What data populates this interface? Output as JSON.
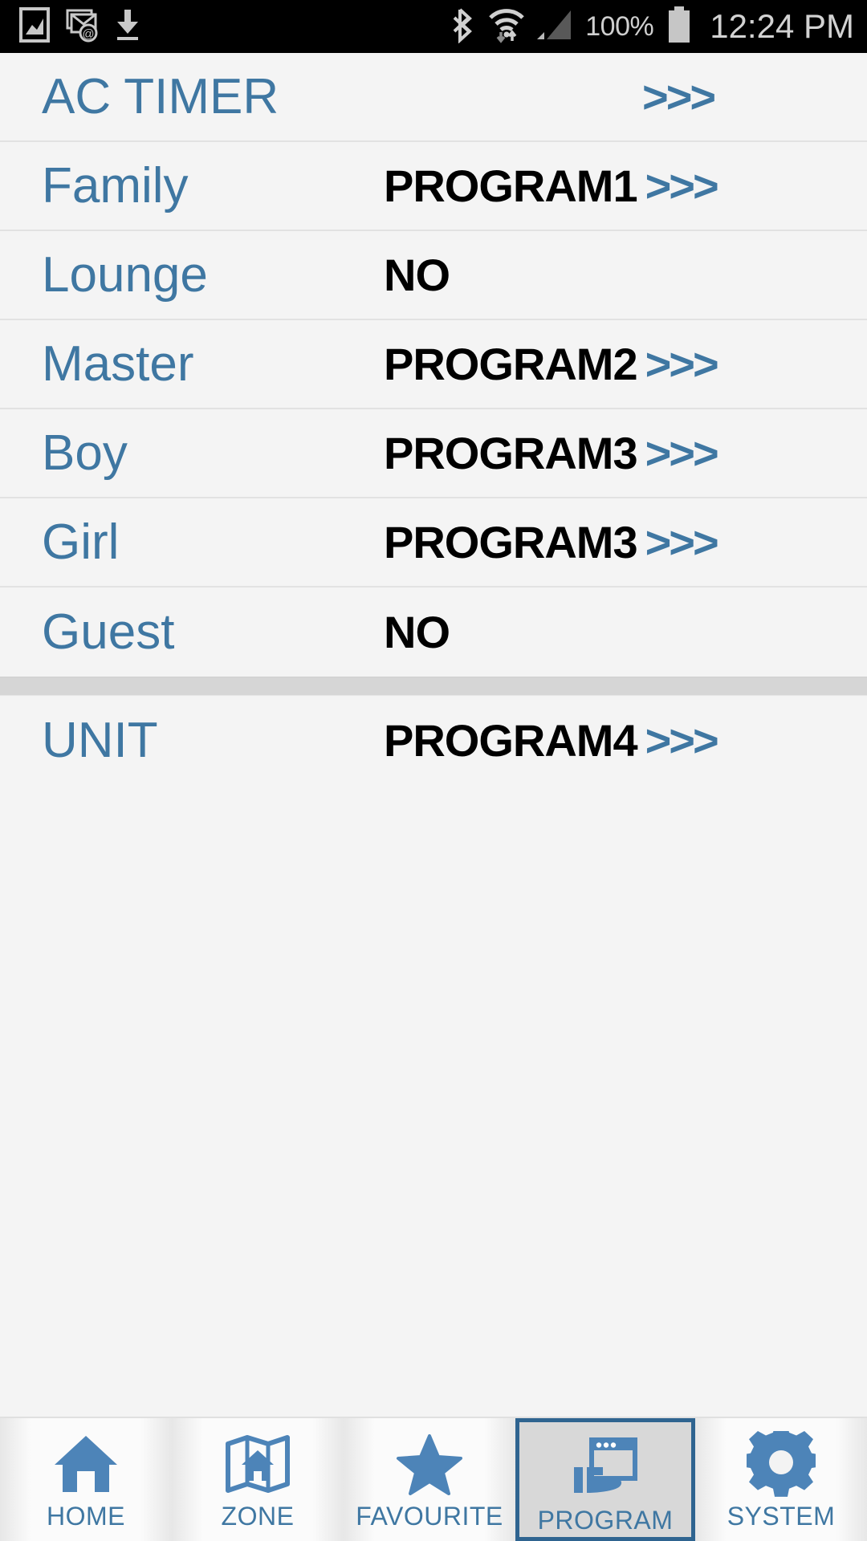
{
  "status_bar": {
    "left_icons": [
      "screenshot-image-icon",
      "email-at-icon",
      "download-icon"
    ],
    "right_icons": [
      "bluetooth-icon",
      "wifi-icon",
      "cellular-signal-icon",
      "battery-icon"
    ],
    "battery_percent": "100%",
    "time": "12:24 PM"
  },
  "header": {
    "title": "AC TIMER",
    "chevron": ">>>"
  },
  "zone_rows": [
    {
      "label": "Family",
      "value": "PROGRAM1",
      "chevron": ">>>",
      "has_chevron": true
    },
    {
      "label": "Lounge",
      "value": "NO",
      "chevron": "",
      "has_chevron": false
    },
    {
      "label": "Master",
      "value": "PROGRAM2",
      "chevron": ">>>",
      "has_chevron": true
    },
    {
      "label": "Boy",
      "value": "PROGRAM3",
      "chevron": ">>>",
      "has_chevron": true
    },
    {
      "label": "Girl",
      "value": "PROGRAM3",
      "chevron": ">>>",
      "has_chevron": true
    },
    {
      "label": "Guest",
      "value": "NO",
      "chevron": "",
      "has_chevron": false
    }
  ],
  "unit_row": {
    "label": "UNIT",
    "value": "PROGRAM4",
    "chevron": ">>>",
    "has_chevron": true
  },
  "tabs": [
    {
      "label": "HOME",
      "icon": "home-icon",
      "selected": false
    },
    {
      "label": "ZONE",
      "icon": "map-zone-icon",
      "selected": false
    },
    {
      "label": "FAVOURITE",
      "icon": "star-icon",
      "selected": false
    },
    {
      "label": "PROGRAM",
      "icon": "program-window-hand-icon",
      "selected": true
    },
    {
      "label": "SYSTEM",
      "icon": "gear-icon",
      "selected": false
    }
  ],
  "colors": {
    "accent_blue": "#3f77a2",
    "selected_border": "#2f6490",
    "value_black": "#000000",
    "page_background": "#f4f4f4",
    "status_bar_background": "#000000",
    "section_divider": "#d6d6d6"
  }
}
